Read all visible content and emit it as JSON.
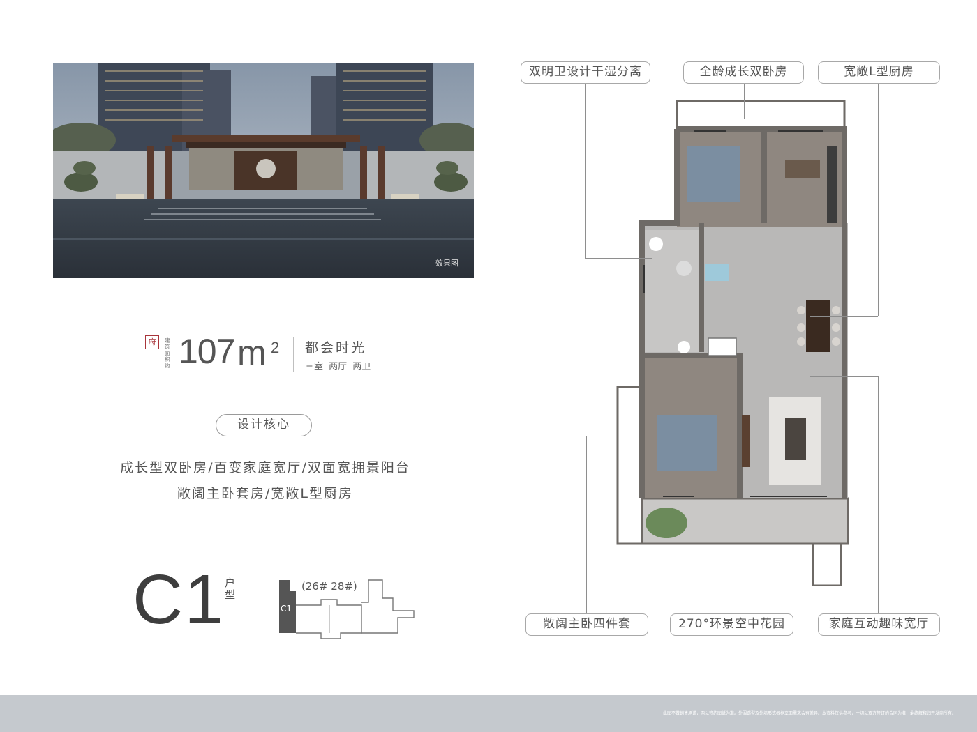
{
  "rendering": {
    "caption": "效果图"
  },
  "area": {
    "seal_char": "府",
    "caption": "建筑面积约",
    "number": "107",
    "unit": "m",
    "superscript": "2"
  },
  "series": {
    "name": "都会时光",
    "layout": "三室 两厅 两卫"
  },
  "core": {
    "title": "设计核心",
    "line1": "成长型双卧房/百变家庭宽厅/双面宽拥景阳台",
    "line2": "敞阔主卧套房/宽敞L型厨房"
  },
  "unit": {
    "code": "C1",
    "label": "户型",
    "buildings": "(26# 28#)",
    "keyplan_code": "C1"
  },
  "callouts": {
    "top_left": "双明卫设计干湿分离",
    "top_middle": "全龄成长双卧房",
    "top_right": "宽敞L型厨房",
    "bottom_left": "敞阔主卧四件套",
    "bottom_middle": "270°环景空中花园",
    "bottom_right": "家庭互动趣味宽厅"
  },
  "footer": {
    "disclaimer": "此图不做销售承诺，两以签约图纸为准。外围透型及外墙形式根据立面需求会有差异。本资料仅供参考，一切以双方签订的合同为准，最终解释归开发商所有。"
  },
  "colors": {
    "wall": "#6e6a66",
    "floor_stone": "#b9b8b7",
    "floor_wood": "#8f8780",
    "seal_red": "#a8343a",
    "footer_band": "#c5c9ce"
  }
}
